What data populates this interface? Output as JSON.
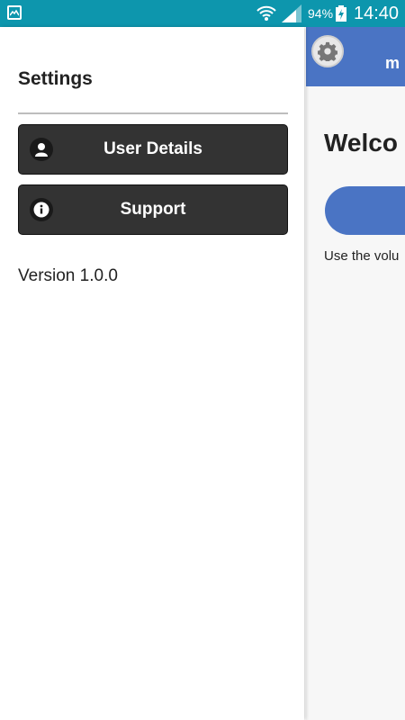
{
  "status_bar": {
    "battery_percent": "94%",
    "time": "14:40",
    "background_color": "#0d96ad",
    "icons": [
      "gallery-icon",
      "wifi-icon",
      "signal-icon",
      "battery-charging-icon"
    ]
  },
  "drawer": {
    "title": "Settings",
    "items": [
      {
        "label": "User Details",
        "icon": "user-icon"
      },
      {
        "label": "Support",
        "icon": "info-icon"
      }
    ],
    "version": "Version 1.0.0"
  },
  "main": {
    "header_title_partial": "m",
    "welcome_partial": "Welco",
    "hint_partial": "Use the volu",
    "accent_color": "#4a74c4",
    "settings_icon": "gear-icon"
  }
}
